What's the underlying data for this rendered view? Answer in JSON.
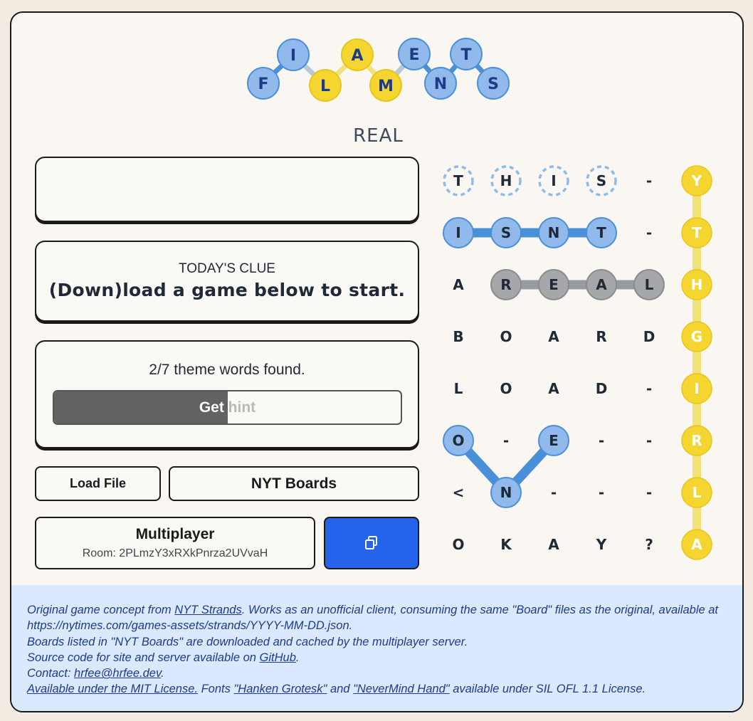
{
  "logo": {
    "letters": [
      "F",
      "I",
      "L",
      "A",
      "M",
      "E",
      "N",
      "T",
      "S"
    ],
    "letter_colors": [
      "blue",
      "blue",
      "yellow",
      "yellow",
      "yellow",
      "blue",
      "blue",
      "blue",
      "blue"
    ]
  },
  "game": {
    "title": "REAL",
    "found_words_text": "",
    "clue_label": "TODAY'S CLUE",
    "clue_text": "(Down)load a game below to start.",
    "progress_text": "2/7 theme words found.",
    "hint_label_lit": "Get",
    "hint_label_dim": " hint",
    "hint_progress": 0.5
  },
  "buttons": {
    "load_file": "Load File",
    "nyt_boards": "NYT Boards",
    "multiplayer_title": "Multiplayer",
    "room_label": "Room: 2PLmzY3xRXkPnrza2UVvaH",
    "copy_icon": "copy-icon"
  },
  "board": {
    "rows": [
      [
        "T",
        "H",
        "I",
        "S",
        "-",
        "Y"
      ],
      [
        "I",
        "S",
        "N",
        "T",
        "-",
        "T"
      ],
      [
        "A",
        "R",
        "E",
        "A",
        "L",
        "H"
      ],
      [
        "B",
        "O",
        "A",
        "R",
        "D",
        "G"
      ],
      [
        "L",
        "O",
        "A",
        "D",
        "-",
        "I"
      ],
      [
        "O",
        "-",
        "E",
        "-",
        "-",
        "R"
      ],
      [
        "<",
        "N",
        "-",
        "-",
        "-",
        "L"
      ],
      [
        "O",
        "K",
        "A",
        "Y",
        "?",
        "A"
      ]
    ],
    "colors": {
      "blue": "#91b9eb",
      "blue_line": "#4a90d9",
      "yellow": "#f5d630",
      "yellow_line": "#f3e27a",
      "gray": "#a6a7ab",
      "gray_line": "#999a9e"
    }
  },
  "footer": {
    "line1_a": "Original game concept from ",
    "line1_link": "NYT Strands",
    "line1_b": ". Works as an unofficial client, consuming the same \"Board\" files as the original, available at https://nytimes.com/games-assets/strands/YYYY-MM-DD.json.",
    "line2": "Boards listed in \"NYT Boards\" are downloaded and cached by the multiplayer server.",
    "line3_a": "Source code for site and server available on ",
    "line3_link": "GitHub",
    "line3_b": ".",
    "line4_a": "Contact: ",
    "line4_link": "hrfee@hrfee.dev",
    "line4_b": ".",
    "line5_link1": "Available under the MIT License.",
    "line5_a": " Fonts ",
    "line5_link2": "\"Hanken Grotesk\"",
    "line5_b": " and ",
    "line5_link3": "\"NeverMind Hand\"",
    "line5_c": " available under SIL OFL 1.1 License."
  }
}
